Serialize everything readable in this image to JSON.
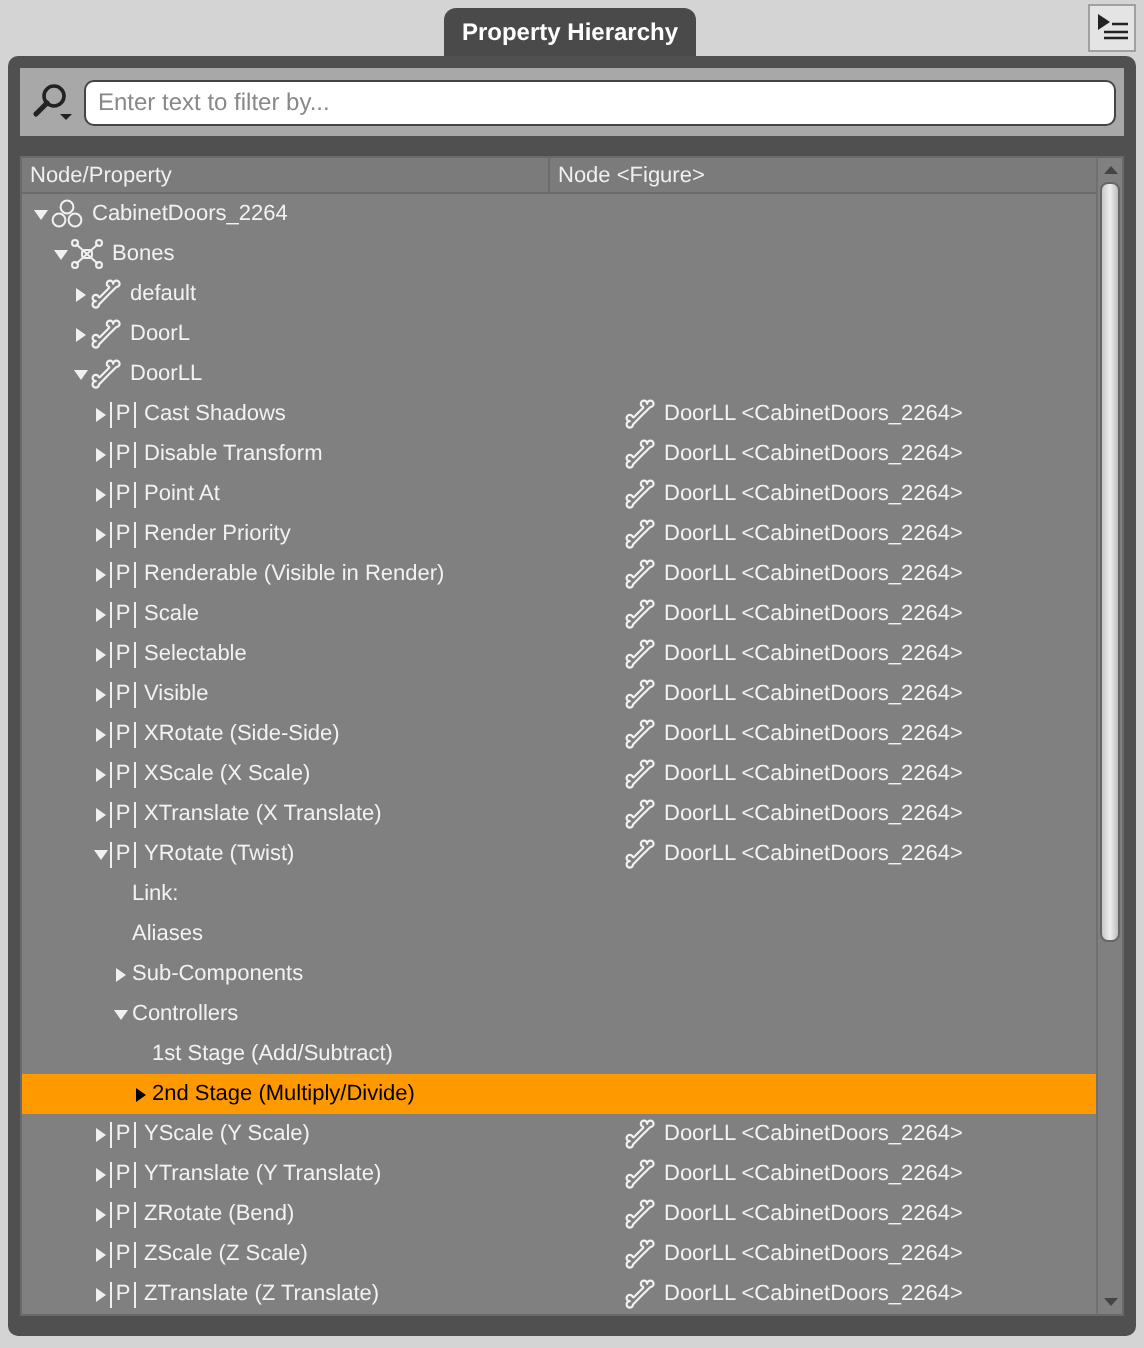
{
  "tab": {
    "label": "Property Hierarchy",
    "selected": true
  },
  "filter": {
    "placeholder": "Enter text to filter by..."
  },
  "columns": [
    "Node/Property",
    "Node <Figure>"
  ],
  "tree": [
    {
      "kind": "figure",
      "label": "CabinetDoors_2264",
      "expanded": true,
      "selected": false,
      "children": [
        {
          "kind": "bones",
          "label": "Bones",
          "expanded": true,
          "selected": false,
          "children": [
            {
              "kind": "bone",
              "label": "default",
              "expanded": false,
              "selected": false
            },
            {
              "kind": "bone",
              "label": "DoorL",
              "expanded": false,
              "selected": false
            },
            {
              "kind": "bone",
              "label": "DoorLL",
              "expanded": true,
              "selected": false,
              "children": [
                {
                  "kind": "property",
                  "badge": "P",
                  "label": "Cast Shadows",
                  "node": "DoorLL <CabinetDoors_2264>",
                  "expanded": false,
                  "selected": false
                },
                {
                  "kind": "property",
                  "badge": "P",
                  "label": "Disable Transform",
                  "node": "DoorLL <CabinetDoors_2264>",
                  "expanded": false,
                  "selected": false
                },
                {
                  "kind": "property",
                  "badge": "P",
                  "label": "Point At",
                  "node": "DoorLL <CabinetDoors_2264>",
                  "expanded": false,
                  "selected": false
                },
                {
                  "kind": "property",
                  "badge": "P",
                  "label": "Render Priority",
                  "node": "DoorLL <CabinetDoors_2264>",
                  "expanded": false,
                  "selected": false
                },
                {
                  "kind": "property",
                  "badge": "P",
                  "label": "Renderable (Visible in Render)",
                  "node": "DoorLL <CabinetDoors_2264>",
                  "expanded": false,
                  "selected": false
                },
                {
                  "kind": "property",
                  "badge": "P",
                  "label": "Scale",
                  "node": "DoorLL <CabinetDoors_2264>",
                  "expanded": false,
                  "selected": false
                },
                {
                  "kind": "property",
                  "badge": "P",
                  "label": "Selectable",
                  "node": "DoorLL <CabinetDoors_2264>",
                  "expanded": false,
                  "selected": false
                },
                {
                  "kind": "property",
                  "badge": "P",
                  "label": "Visible",
                  "node": "DoorLL <CabinetDoors_2264>",
                  "expanded": false,
                  "selected": false
                },
                {
                  "kind": "property",
                  "badge": "P",
                  "label": "XRotate (Side-Side)",
                  "node": "DoorLL <CabinetDoors_2264>",
                  "expanded": false,
                  "selected": false
                },
                {
                  "kind": "property",
                  "badge": "P",
                  "label": "XScale (X Scale)",
                  "node": "DoorLL <CabinetDoors_2264>",
                  "expanded": false,
                  "selected": false
                },
                {
                  "kind": "property",
                  "badge": "P",
                  "label": "XTranslate (X Translate)",
                  "node": "DoorLL <CabinetDoors_2264>",
                  "expanded": false,
                  "selected": false
                },
                {
                  "kind": "property",
                  "badge": "P",
                  "label": "YRotate (Twist)",
                  "node": "DoorLL <CabinetDoors_2264>",
                  "expanded": true,
                  "selected": false,
                  "children": [
                    {
                      "label": "Link:",
                      "selected": false
                    },
                    {
                      "label": "Aliases",
                      "selected": false
                    },
                    {
                      "label": "Sub-Components",
                      "expanded": false,
                      "selected": false
                    },
                    {
                      "label": "Controllers",
                      "expanded": true,
                      "selected": false,
                      "children": [
                        {
                          "label": "1st Stage (Add/Subtract)",
                          "selected": false
                        },
                        {
                          "label": "2nd Stage (Multiply/Divide)",
                          "expanded": false,
                          "selected": true
                        }
                      ]
                    }
                  ]
                },
                {
                  "kind": "property",
                  "badge": "P",
                  "label": "YScale (Y Scale)",
                  "node": "DoorLL <CabinetDoors_2264>",
                  "expanded": false,
                  "selected": false
                },
                {
                  "kind": "property",
                  "badge": "P",
                  "label": "YTranslate (Y Translate)",
                  "node": "DoorLL <CabinetDoors_2264>",
                  "expanded": false,
                  "selected": false
                },
                {
                  "kind": "property",
                  "badge": "P",
                  "label": "ZRotate (Bend)",
                  "node": "DoorLL <CabinetDoors_2264>",
                  "expanded": false,
                  "selected": false
                },
                {
                  "kind": "property",
                  "badge": "P",
                  "label": "ZScale (Z Scale)",
                  "node": "DoorLL <CabinetDoors_2264>",
                  "expanded": false,
                  "selected": false
                },
                {
                  "kind": "property",
                  "badge": "P",
                  "label": "ZTranslate (Z Translate)",
                  "node": "DoorLL <CabinetDoors_2264>",
                  "expanded": false,
                  "selected": false
                }
              ]
            }
          ]
        }
      ]
    }
  ]
}
